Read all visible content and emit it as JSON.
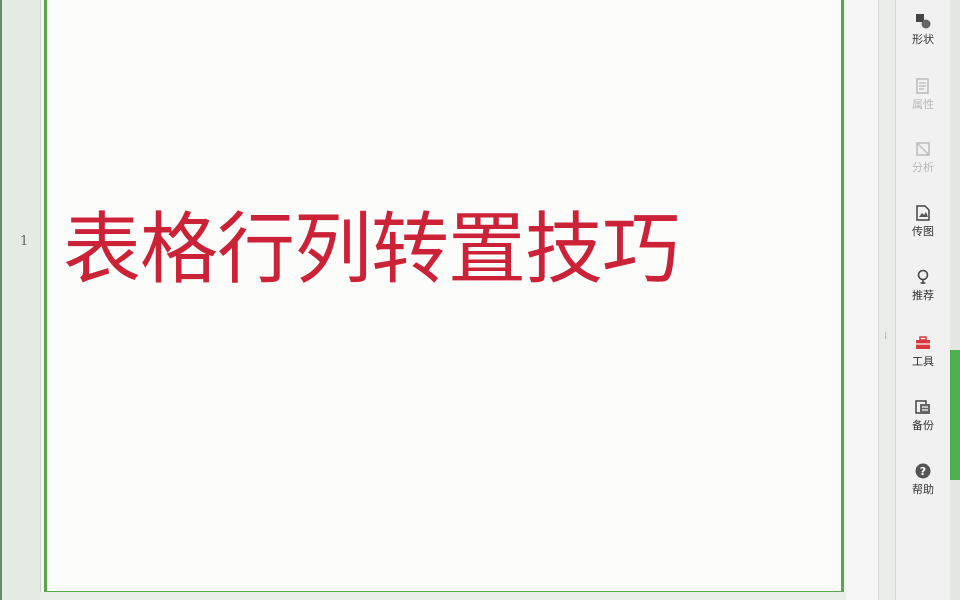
{
  "ruler": {
    "row_number": "1"
  },
  "slide": {
    "title_text": "表格行列转置技巧"
  },
  "sidebar": {
    "items": [
      {
        "label": "形状",
        "icon": "shapes-icon",
        "enabled": true
      },
      {
        "label": "属性",
        "icon": "properties-icon",
        "enabled": false
      },
      {
        "label": "分析",
        "icon": "analyze-icon",
        "enabled": false
      },
      {
        "label": "传图",
        "icon": "upload-image-icon",
        "enabled": true
      },
      {
        "label": "推荐",
        "icon": "recommend-icon",
        "enabled": true
      },
      {
        "label": "工具",
        "icon": "toolbox-icon",
        "enabled": true
      },
      {
        "label": "备份",
        "icon": "backup-icon",
        "enabled": true
      },
      {
        "label": "帮助",
        "icon": "help-icon",
        "enabled": true
      }
    ]
  },
  "colors": {
    "title": "#cc2238",
    "frame": "#5aa64a",
    "accent": "#4caf50",
    "toolbox": "#d9383c"
  }
}
